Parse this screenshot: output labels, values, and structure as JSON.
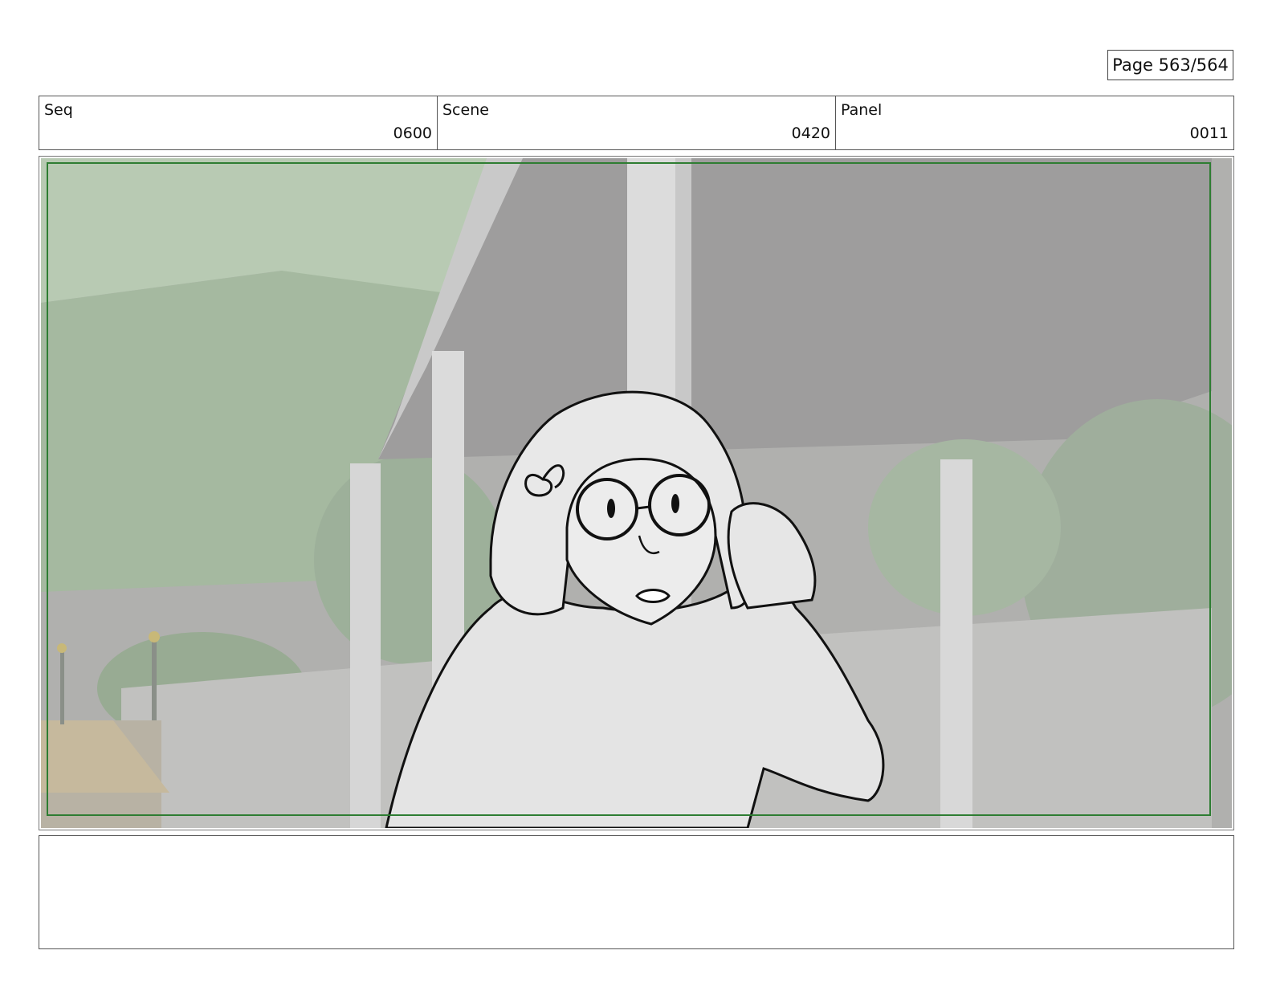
{
  "page": {
    "label": "Page 563/564"
  },
  "header": {
    "seq": {
      "label": "Seq",
      "value": "0600"
    },
    "scene": {
      "label": "Scene",
      "value": "0420"
    },
    "panel": {
      "label": "Panel",
      "value": "0011"
    }
  },
  "frame": {
    "safe_area_color": "#2e7d32",
    "sky_color": "#a09f9f",
    "hill_color": "#b6c8b0",
    "canopy_color": "#9d9c9c",
    "pillar_color": "#d8d8d8"
  },
  "notes": {
    "text": ""
  }
}
